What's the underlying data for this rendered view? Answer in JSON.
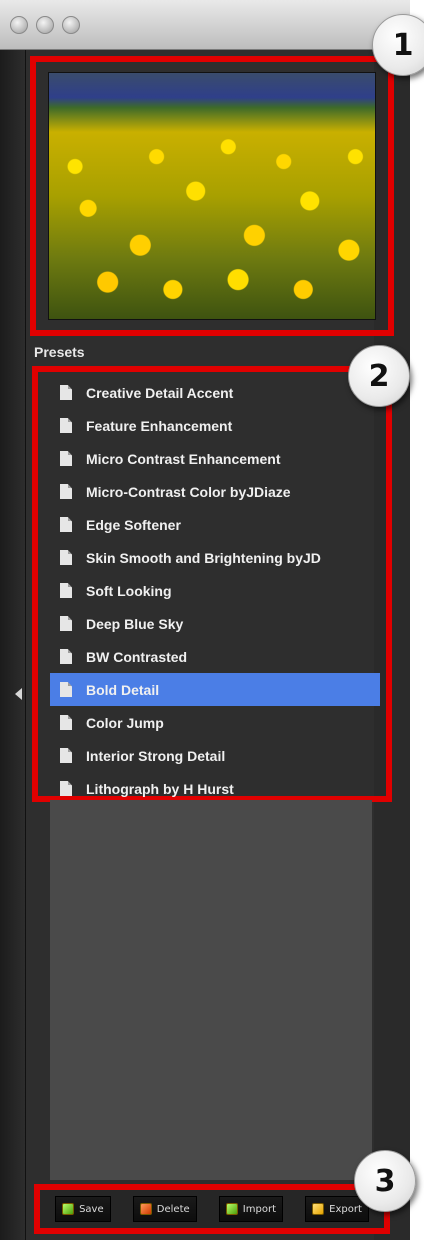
{
  "callouts": [
    "1",
    "2",
    "3"
  ],
  "preview": {
    "image": "yellow daffodil field"
  },
  "presets": {
    "label": "Presets",
    "items": [
      {
        "label": "Creative Detail Accent",
        "selected": false
      },
      {
        "label": "Feature Enhancement",
        "selected": false
      },
      {
        "label": "Micro Contrast Enhancement",
        "selected": false
      },
      {
        "label": "Micro-Contrast Color byJDiaze",
        "selected": false
      },
      {
        "label": "Edge Softener",
        "selected": false
      },
      {
        "label": "Skin Smooth and Brightening byJD",
        "selected": false
      },
      {
        "label": "Soft Looking",
        "selected": false
      },
      {
        "label": "Deep Blue Sky",
        "selected": false
      },
      {
        "label": "BW Contrasted",
        "selected": false
      },
      {
        "label": "Bold Detail",
        "selected": true
      },
      {
        "label": "Color Jump",
        "selected": false
      },
      {
        "label": "Interior Strong Detail",
        "selected": false
      },
      {
        "label": "Lithograph by H Hurst",
        "selected": false
      }
    ]
  },
  "toolbar": {
    "save": "Save",
    "delete": "Delete",
    "import": "Import",
    "export": "Export"
  },
  "colors": {
    "selection": "#4b7ee6",
    "highlight_frame": "#e00000"
  }
}
